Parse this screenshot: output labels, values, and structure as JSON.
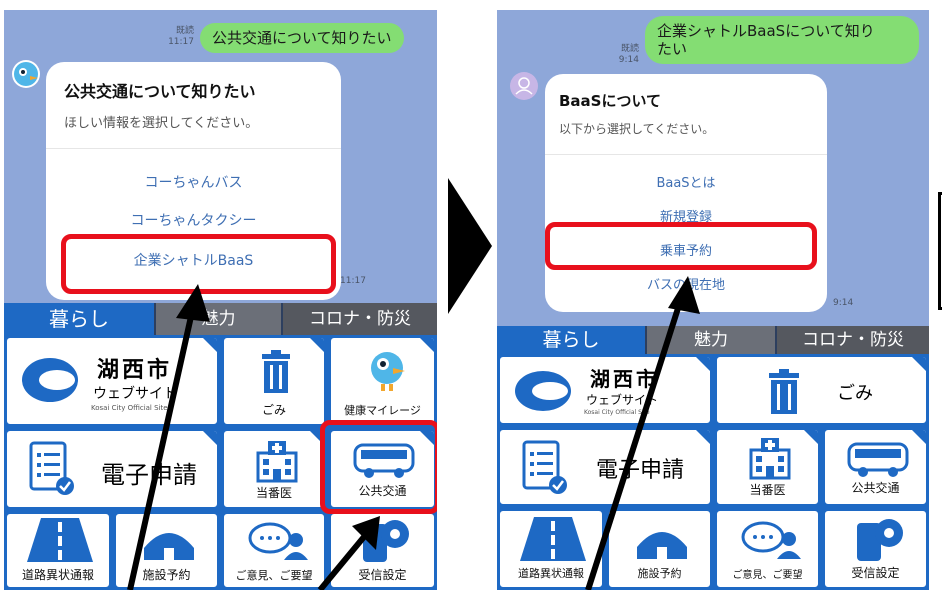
{
  "left": {
    "user_message": "公共交通について知りたい",
    "read_label": "既読",
    "user_time": "11:17",
    "card_title": "公共交通について知りたい",
    "card_subtitle": "ほしい情報を選択してください。",
    "options": [
      "コーちゃんバス",
      "コーちゃんタクシー",
      "企業シャトルBaaS"
    ],
    "card_time": "11:17"
  },
  "right": {
    "user_message_line1": "企業シャトルBaaSについて知り",
    "user_message_line2": "たい",
    "read_label": "既読",
    "user_time": "9:14",
    "card_title": "BaaSについて",
    "card_subtitle": "以下から選択してください。",
    "options": [
      "BaaSとは",
      "新規登録",
      "乗車予約",
      "バスの現在地"
    ],
    "card_time": "9:14"
  },
  "tabs": [
    "暮らし",
    "魅力",
    "コロナ・防災"
  ],
  "menu": {
    "city_title": "湖西市",
    "city_sub": "ウェブサイト",
    "city_en": "Kosai City Official Site",
    "garbage": "ごみ",
    "health": "健康マイレージ",
    "e_application": "電子申請",
    "on_duty_doctor": "当番医",
    "public_transport": "公共交通",
    "road_report": "道路異状通報",
    "facility_reservation": "施設予約",
    "feedback": "ご意見、ご要望",
    "notification_settings": "受信設定"
  },
  "colors": {
    "chat_bg": "#8ea7d9",
    "accent": "#1e69c4",
    "highlight": "#e8101c",
    "bubble": "#84dd73"
  }
}
